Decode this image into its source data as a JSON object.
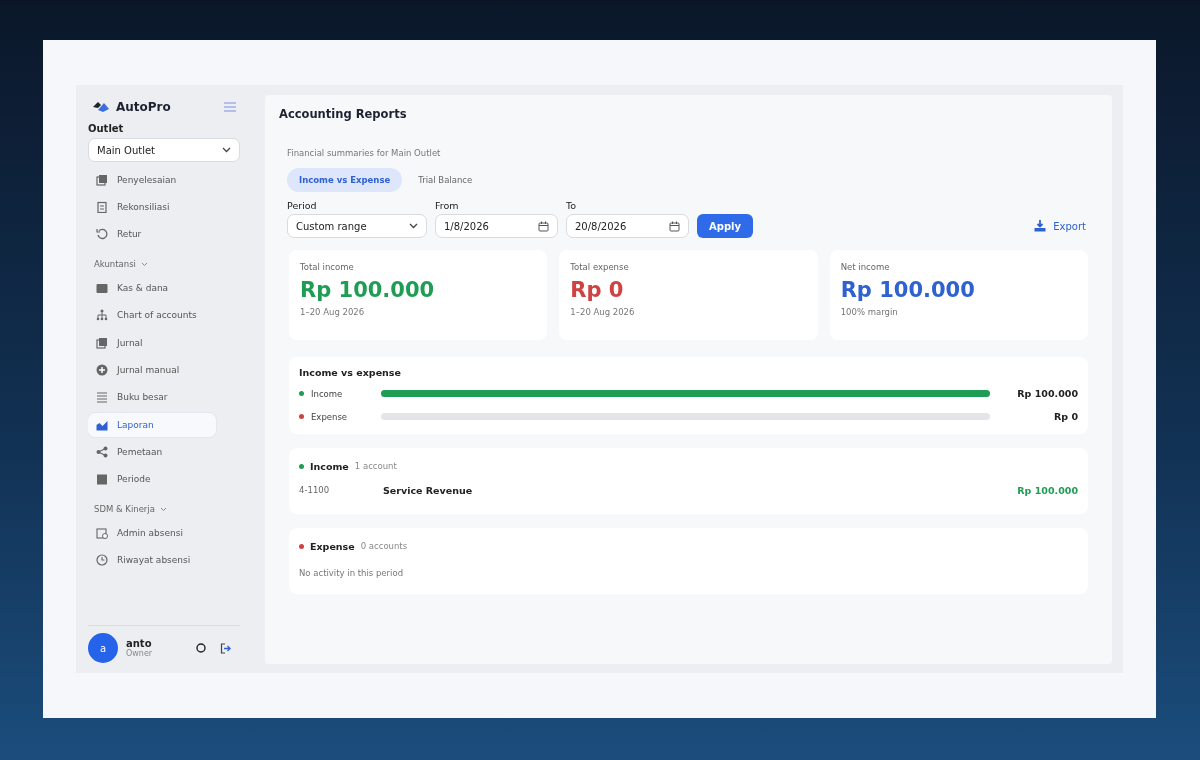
{
  "brand": {
    "name": "AutoPro"
  },
  "outlet": {
    "label": "Outlet",
    "value": "Main Outlet"
  },
  "nav": [
    {
      "kind": "link",
      "label": "Penyelesaian",
      "selected": false
    },
    {
      "kind": "link",
      "label": "Rekonsiliasi",
      "selected": false
    },
    {
      "kind": "link",
      "label": "Retur",
      "selected": false
    },
    {
      "kind": "section",
      "label": "Akuntansi",
      "expanded": true
    },
    {
      "kind": "link",
      "label": "Kas & dana",
      "selected": false
    },
    {
      "kind": "link",
      "label": "Chart of accounts",
      "selected": false
    },
    {
      "kind": "link",
      "label": "Jurnal",
      "selected": false
    },
    {
      "kind": "link",
      "label": "Jurnal manual",
      "selected": false
    },
    {
      "kind": "link",
      "label": "Buku besar",
      "selected": false
    },
    {
      "kind": "link",
      "label": "Laporan",
      "selected": true
    },
    {
      "kind": "link",
      "label": "Pemetaan",
      "selected": false
    },
    {
      "kind": "link",
      "label": "Periode",
      "selected": false
    },
    {
      "kind": "section",
      "label": "SDM & Kinerja",
      "expanded": true
    },
    {
      "kind": "link",
      "label": "Admin absensi",
      "selected": false
    },
    {
      "kind": "link",
      "label": "Riwayat absensi",
      "selected": false
    }
  ],
  "user": {
    "initial": "a",
    "name": "anto",
    "role": "Owner"
  },
  "page": {
    "title": "Accounting Reports",
    "subtitle": "Financial summaries for Main Outlet"
  },
  "tabs": [
    {
      "label": "Income vs Expense",
      "selected": true
    },
    {
      "label": "Trial Balance",
      "selected": false
    }
  ],
  "filters": {
    "period_label": "Period",
    "period": "Custom range",
    "from_label": "From",
    "from": "1/8/2026",
    "to_label": "To",
    "to": "20/8/2026",
    "apply": "Apply",
    "export": "Export"
  },
  "cards": [
    {
      "label": "Total income",
      "value": "Rp 100.000",
      "note": "1–20 Aug 2026",
      "color": "#1f9d55"
    },
    {
      "label": "Total expense",
      "value": "Rp 0",
      "note": "1–20 Aug 2026",
      "color": "#d04141"
    },
    {
      "label": "Net income",
      "value": "Rp 100.000",
      "note": "100% margin",
      "color": "#2f62d0"
    }
  ],
  "comparison": {
    "title": "Income vs expense",
    "rows": [
      {
        "label": "Income",
        "color": "#1f9d55",
        "level": 1.0,
        "amount": "Rp 100.000"
      },
      {
        "label": "Expense",
        "color": "#d04141",
        "level": 0,
        "amount": "Rp 0"
      }
    ]
  },
  "groups": [
    {
      "title": "Income",
      "count": "1 account",
      "color": "#1f9d55",
      "accounts": [
        {
          "code": "4-1100",
          "name": "Service Revenue",
          "amount": "Rp 100.000"
        }
      ]
    },
    {
      "title": "Expense",
      "count": "0 accounts",
      "color": "#d04141",
      "empty": "No activity in this period"
    }
  ]
}
